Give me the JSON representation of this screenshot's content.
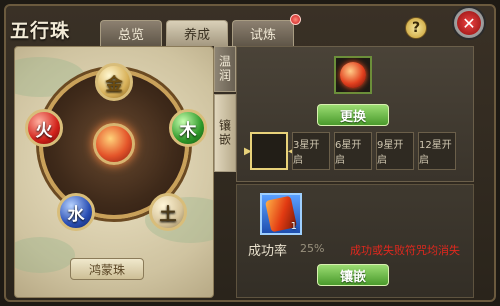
{
  "window": {
    "title": "五行珠"
  },
  "tabs": [
    {
      "label": "总览",
      "active": false
    },
    {
      "label": "养成",
      "active": true
    },
    {
      "label": "试炼",
      "active": false,
      "notification": true
    }
  ],
  "header": {
    "help_symbol": "?",
    "close_symbol": "✕"
  },
  "wheel": {
    "name": "鸿蒙珠",
    "orbs": [
      {
        "element": "gold",
        "glyph": "金"
      },
      {
        "element": "wood",
        "glyph": "木"
      },
      {
        "element": "earth",
        "glyph": "土"
      },
      {
        "element": "water",
        "glyph": "水"
      },
      {
        "element": "fire",
        "glyph": "火"
      }
    ]
  },
  "side_tabs": [
    {
      "label": "温润",
      "active": false
    },
    {
      "label": "镶嵌",
      "active": true
    }
  ],
  "inlay": {
    "replace_label": "更换",
    "star_slots": [
      "",
      "3星开启",
      "6星开启",
      "9星开启",
      "12星开启"
    ],
    "item_count": "1",
    "success_rate_label": "成功率",
    "success_rate_value": "25%",
    "failure_note": "成功或失败符咒均消失",
    "inlay_label": "镶嵌"
  },
  "colors": {
    "accent_green": "#4a9a2c",
    "warning_red": "#e0281e",
    "gold_border": "#e8d27a"
  }
}
